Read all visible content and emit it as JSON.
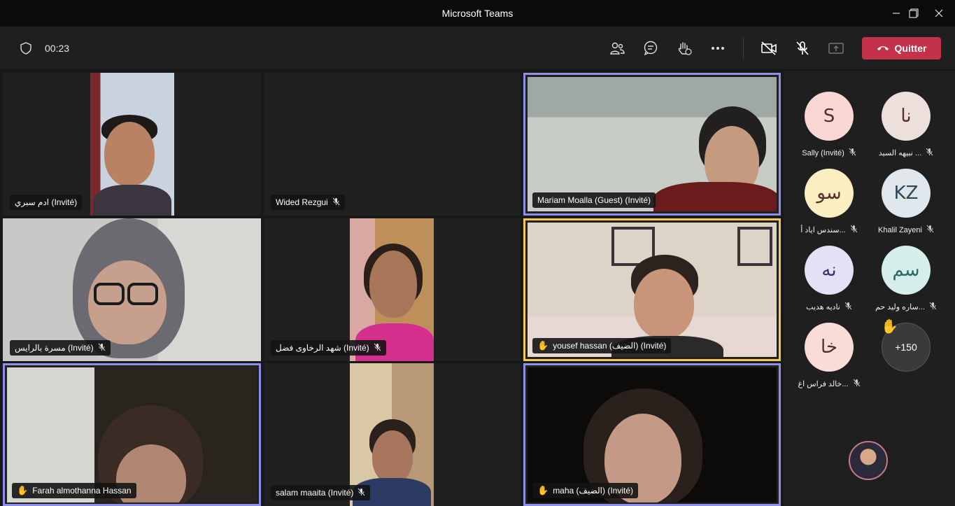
{
  "window": {
    "title": "Microsoft Teams"
  },
  "toolbar": {
    "timer": "00:23",
    "leave_label": "Quitter",
    "icons": [
      "shield-icon",
      "people-icon",
      "chat-icon",
      "raise-hand-icon",
      "more-icon",
      "camera-off-icon",
      "mic-off-icon",
      "share-icon",
      "phone-hangup-icon"
    ]
  },
  "tiles": [
    {
      "name": "ادم سبري (Invité)",
      "muted": false,
      "hand": false
    },
    {
      "name": "Wided Rezgui",
      "muted": true,
      "hand": false
    },
    {
      "name": "Mariam Moalla (Guest) (Invité)",
      "muted": false,
      "hand": false
    },
    {
      "name": "مسرة بالرايس (Invité)",
      "muted": true,
      "hand": false
    },
    {
      "name": "شهد الرخاوى فضل (Invité)",
      "muted": true,
      "hand": false
    },
    {
      "name": "yousef hassan (الضيف) (Invité)",
      "muted": false,
      "hand": true
    },
    {
      "name": "Farah almothanna Hassan",
      "muted": false,
      "hand": true
    },
    {
      "name": "salam maaita (Invité)",
      "muted": true,
      "hand": false
    },
    {
      "name": "maha (الضيف) (Invité)",
      "muted": false,
      "hand": true
    }
  ],
  "roster": [
    {
      "initials": "S",
      "name": "Sally (Invité)",
      "color": "#f9d7d3"
    },
    {
      "initials": "نا",
      "name": "نبيهه السيد ...",
      "color": "#ede0dc"
    },
    {
      "initials": "سو",
      "name": "سندس اياد أ...",
      "color": "#fbeec0"
    },
    {
      "initials": "KZ",
      "name": "Khalil Zayeni",
      "color": "#dfe6ec"
    },
    {
      "initials": "نه",
      "name": "ناديه هديب",
      "color": "#e4e0f5"
    },
    {
      "initials": "سم",
      "name": "ساره وليد حم...",
      "color": "#d5f0ec"
    },
    {
      "initials": "خا",
      "name": "خالد فراس اغ...",
      "color": "#f9dcd7"
    }
  ],
  "overflow": {
    "label": "+150"
  },
  "colors": {
    "accent": "#8f8fe8",
    "active_speaker": "#f2c94c",
    "leave": "#c4314b"
  }
}
